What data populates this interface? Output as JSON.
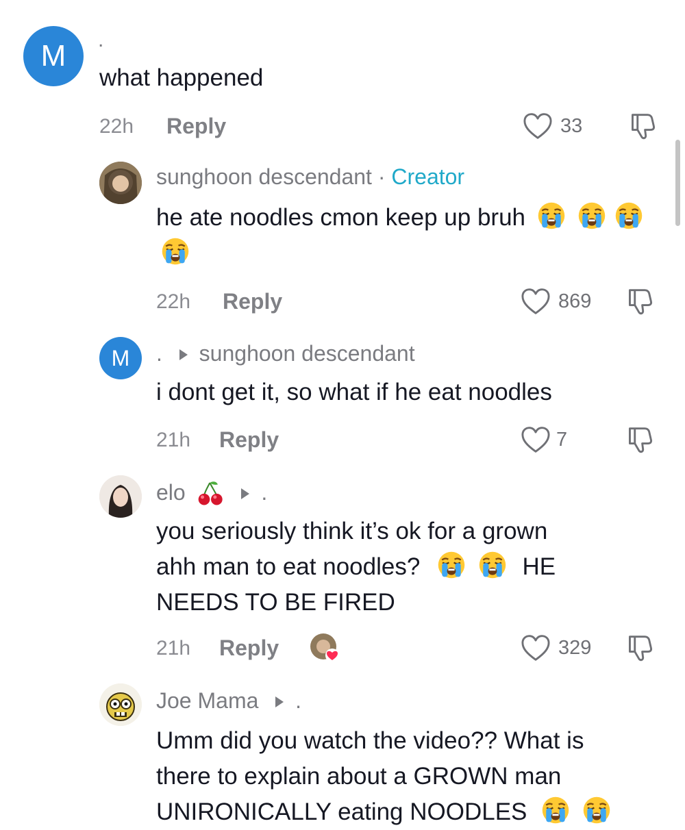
{
  "comments": [
    {
      "avatar_letter": "M",
      "user": ".",
      "text": "what happened",
      "time": "22h",
      "reply_label": "Reply",
      "likes": "33"
    },
    {
      "user": "sunghoon descendant",
      "separator": "·",
      "badge": "Creator",
      "text": "he ate noodles cmon keep up bruh",
      "time": "22h",
      "reply_label": "Reply",
      "likes": "869"
    },
    {
      "avatar_letter": "M",
      "user": ".",
      "reply_to": "sunghoon descendant",
      "text": "i dont get it, so what if he eat noodles",
      "time": "21h",
      "reply_label": "Reply",
      "likes": "7"
    },
    {
      "user": "elo",
      "reply_to": ".",
      "text_line1": "you seriously think it’s ok for a grown",
      "text_line2": "ahh man to eat noodles?",
      "text_line2b": "HE",
      "text_line3": "NEEDS TO BE FIRED",
      "time": "21h",
      "reply_label": "Reply",
      "likes": "329"
    },
    {
      "user": "Joe Mama",
      "reply_to": ".",
      "text_line1": "Umm did you watch the video?? What is",
      "text_line2": "there to explain about a GROWN man",
      "text_line3": "UNIRONICALLY eating NOODLES"
    }
  ],
  "colors": {
    "accent": "#20a9c9",
    "avatar_blue": "#2a86d8",
    "like_heart": "#fe2c55"
  },
  "icons": [
    "heart-icon",
    "dislike-icon",
    "loudly-crying-face-emoji",
    "cherries-emoji",
    "reply-arrow-icon"
  ]
}
